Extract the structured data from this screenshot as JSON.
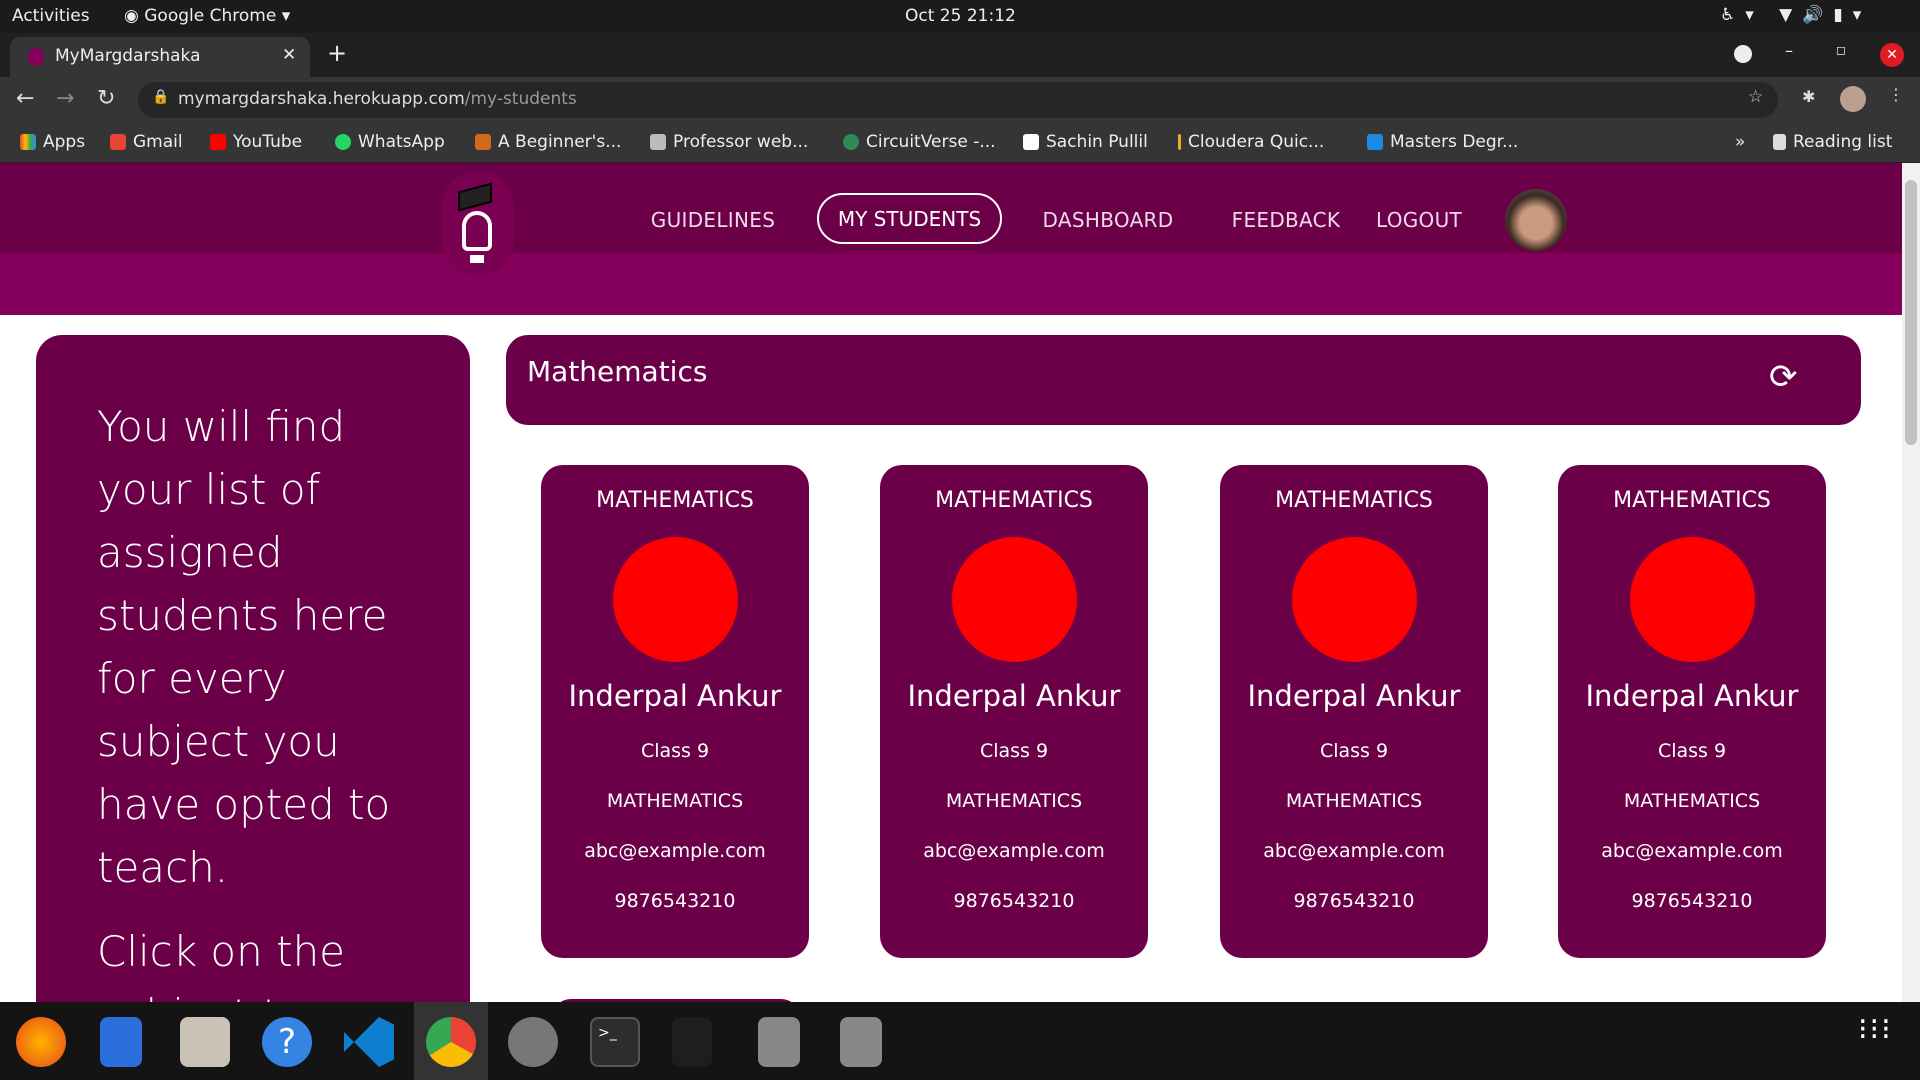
{
  "system": {
    "activities": "Activities",
    "app": "Google Chrome",
    "clock": "Oct 25  21:12"
  },
  "browser": {
    "tab_title": "MyMargdarshaka",
    "url_host": "mymargdarshaka.herokuapp.com",
    "url_path": "/my-students",
    "bookmarks": [
      "Apps",
      "Gmail",
      "YouTube",
      "WhatsApp",
      "A Beginner's...",
      "Professor web...",
      "CircuitVerse -...",
      "Sachin Pullil",
      "Cloudera Quic...",
      "Masters Degr..."
    ],
    "reading_list": "Reading list",
    "overflow": "»"
  },
  "nav": {
    "items": [
      "GUIDELINES",
      "MY STUDENTS",
      "DASHBOARD",
      "FEEDBACK",
      "LOGOUT"
    ],
    "active": "MY STUDENTS"
  },
  "sidebar": {
    "text": "You will find your list of assigned students here for every subject you have opted to teach.",
    "text2": "Click on the subject to ..."
  },
  "subject_header": {
    "title": "Mathematics",
    "refresh_icon": "sync-icon"
  },
  "students": [
    {
      "subject": "MATHEMATICS",
      "name": "Inderpal Ankur",
      "class": "Class 9",
      "subject2": "MATHEMATICS",
      "email": "abc@example.com",
      "phone": "9876543210"
    },
    {
      "subject": "MATHEMATICS",
      "name": "Inderpal Ankur",
      "class": "Class 9",
      "subject2": "MATHEMATICS",
      "email": "abc@example.com",
      "phone": "9876543210"
    },
    {
      "subject": "MATHEMATICS",
      "name": "Inderpal Ankur",
      "class": "Class 9",
      "subject2": "MATHEMATICS",
      "email": "abc@example.com",
      "phone": "9876543210"
    },
    {
      "subject": "MATHEMATICS",
      "name": "Inderpal Ankur",
      "class": "Class 9",
      "subject2": "MATHEMATICS",
      "email": "abc@example.com",
      "phone": "9876543210"
    }
  ],
  "colors": {
    "brand": "#6c0048",
    "band": "#85005c",
    "status_dot": "#ff0000"
  }
}
